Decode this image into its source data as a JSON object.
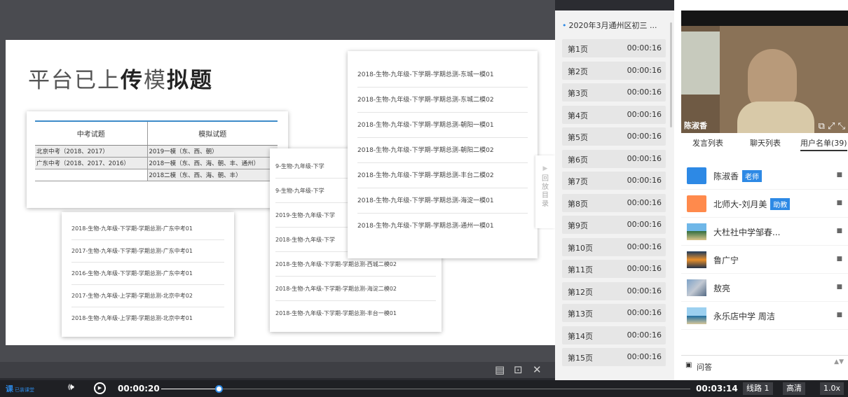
{
  "slide": {
    "title_light_1": "平台已上",
    "title_bold_1": "传",
    "title_light_2": "模",
    "title_bold_2": "拟题",
    "table": {
      "headers": [
        "中考试题",
        "模拟试题"
      ],
      "rows": [
        [
          "北京中考（2018、2017）",
          "2019一模（东、西、朝）"
        ],
        [
          "广东中考（2018、2017、2016）",
          "2018一模（东、西、海、朝、丰、通州）"
        ],
        [
          "",
          "2018二模（东、西、海、朝、丰）"
        ]
      ]
    },
    "card_gd": [
      "2018-生物-九年级-下学期-学期总测-广东中考01",
      "2017-生物-九年级-下学期-学期总测-广东中考01",
      "2016-生物-九年级-下学期-学期总测-广东中考01",
      "2017-生物-九年级-上学期-学期总测-北京中考02",
      "2018-生物-九年级-上学期-学期总测-北京中考01"
    ],
    "card_mid": [
      "9-生物-九年级-下学",
      "9-生物-九年级-下学",
      "2019-生物-九年级-下学",
      "2018-生物-九年级-下学",
      "2018-生物-九年级-下学期-学期总测-西城二模02",
      "2018-生物-九年级-下学期-学期总测-海淀二模02",
      "2018-生物-九年级-下学期-学期总测-丰台一模01"
    ],
    "card_dc": [
      "2018-生物-九年级-下学期-学期总测-东城一模01",
      "2018-生物-九年级-下学期-学期总测-东城二模02",
      "2018-生物-九年级-下学期-学期总测-朝阳一模01",
      "2018-生物-九年级-下学期-学期总测-朝阳二模02",
      "2018-生物-九年级-下学期-学期总测-丰台二模02",
      "2018-生物-九年级-下学期-学期总测-海淀一模01",
      "2018-生物-九年级-下学期-学期总测-通州一模01"
    ],
    "drawer_arrow": "▶",
    "drawer_label": "回放目录"
  },
  "slide_tools": {
    "icon_1": "▤",
    "icon_2": "⊡",
    "icon_3": "✕"
  },
  "pages": {
    "title": "2020年3月通州区初三 ...",
    "bullet": "•",
    "items": [
      {
        "label": "第1页",
        "time": "00:00:16"
      },
      {
        "label": "第2页",
        "time": "00:00:16"
      },
      {
        "label": "第3页",
        "time": "00:00:16"
      },
      {
        "label": "第4页",
        "time": "00:00:16"
      },
      {
        "label": "第5页",
        "time": "00:00:16"
      },
      {
        "label": "第6页",
        "time": "00:00:16"
      },
      {
        "label": "第7页",
        "time": "00:00:16"
      },
      {
        "label": "第8页",
        "time": "00:00:16"
      },
      {
        "label": "第9页",
        "time": "00:00:16"
      },
      {
        "label": "第10页",
        "time": "00:00:16"
      },
      {
        "label": "第11页",
        "time": "00:00:16"
      },
      {
        "label": "第12页",
        "time": "00:00:16"
      },
      {
        "label": "第13页",
        "time": "00:00:16"
      },
      {
        "label": "第14页",
        "time": "00:00:16"
      },
      {
        "label": "第15页",
        "time": "00:00:16"
      }
    ]
  },
  "video": {
    "name": "陈淑香",
    "icons": "⧉ ⤢ ⤡"
  },
  "tabs": {
    "speakers": "发言列表",
    "chat": "聊天列表",
    "users": "用户名单(39)"
  },
  "users": [
    {
      "name": "陈淑香",
      "role": "老师",
      "avatar": "default-blue",
      "device": "■"
    },
    {
      "name": "北师大-刘月美",
      "role": "助教",
      "avatar": "default-orange",
      "device": "■"
    },
    {
      "name": "大杜社中学邹春...",
      "role": "",
      "avatar": "photo-beach",
      "device": "■"
    },
    {
      "name": "鲁广宁",
      "role": "",
      "avatar": "photo-sunset",
      "device": "■"
    },
    {
      "name": "敖亮",
      "role": "",
      "avatar": "photo-city",
      "device": "■"
    },
    {
      "name": "永乐店中学 周洁",
      "role": "",
      "avatar": "photo-sea",
      "device": "■"
    }
  ],
  "qa": {
    "icon": "▣",
    "label": "问答",
    "spinner": "▲▼"
  },
  "player": {
    "logo_main": "课",
    "logo_text": "已装课堂",
    "volume_icon": "🕪",
    "play_icon": "▶",
    "current_time": "00:00:20",
    "total_time": "00:03:14",
    "progress": 0.11,
    "line_label": "线路 1",
    "quality_label": "高清",
    "speed_label": "1.0x"
  },
  "colors": {
    "accent": "#2d89e5"
  }
}
